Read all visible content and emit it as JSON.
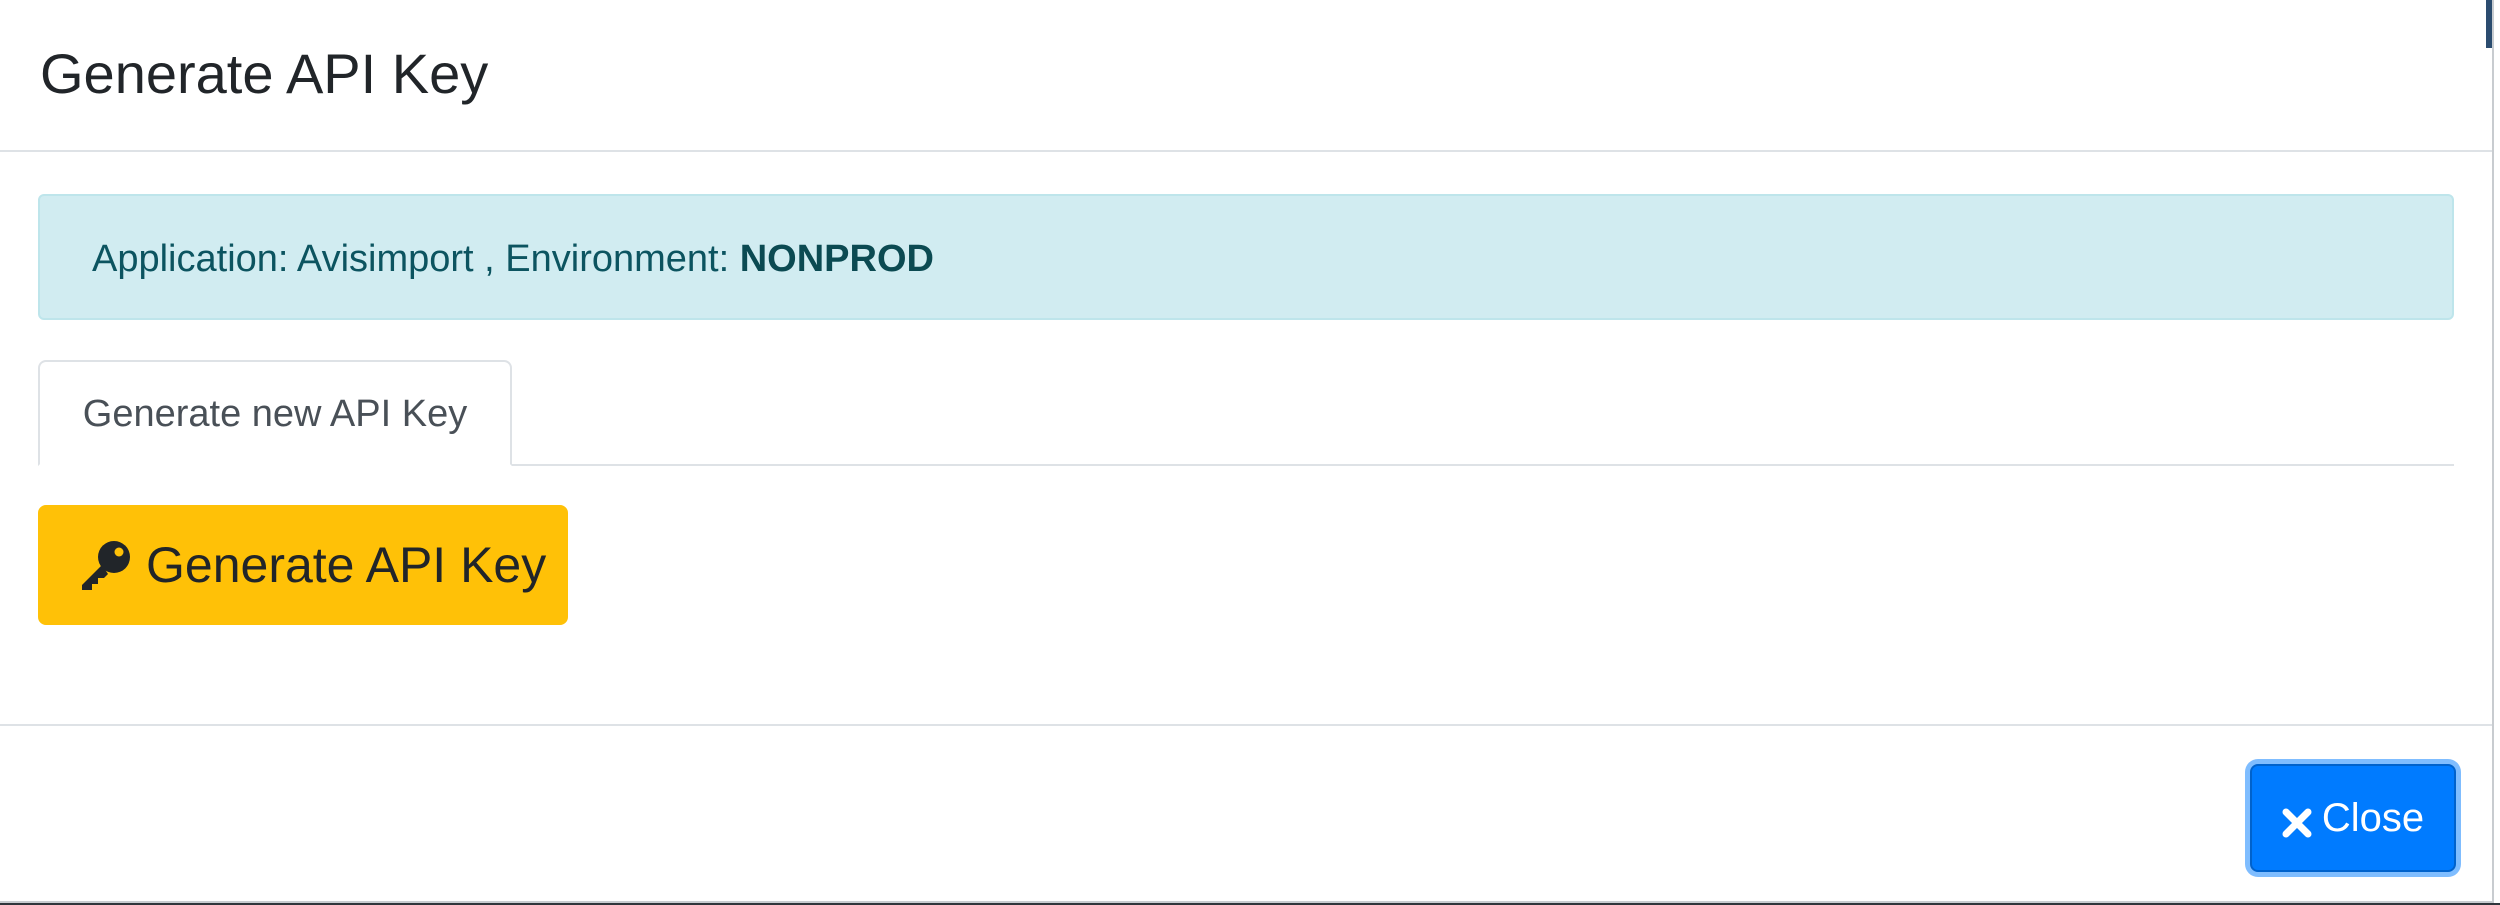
{
  "modal": {
    "title": "Generate API Key"
  },
  "alert": {
    "prefix": "Application: Avisimport , Environment: ",
    "environment": "NONPROD"
  },
  "tabs": [
    {
      "label": "Generate new API Key",
      "active": true
    }
  ],
  "actions": {
    "generate_label": "Generate API Key",
    "generate_icon": "key-icon",
    "close_label": "Close",
    "close_icon": "times-icon"
  },
  "colors": {
    "info_bg": "#d1ecf1",
    "info_text": "#0c5460",
    "warning": "#ffc107",
    "primary": "#007bff"
  }
}
